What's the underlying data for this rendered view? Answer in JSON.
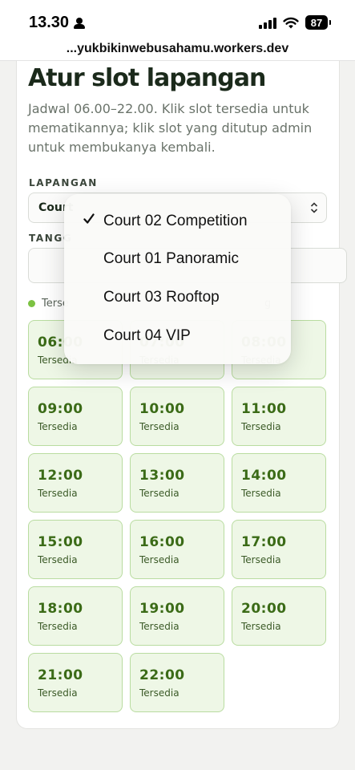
{
  "status_bar": {
    "time": "13.30",
    "battery": "87"
  },
  "browser": {
    "url": "...yukbikinwebusahamu.workers.dev"
  },
  "page": {
    "title": "Atur slot lapangan",
    "description": "Jadwal 06.00–22.00. Klik slot tersedia untuk mematikannya; klik slot yang ditutup admin untuk membukanya kembali.",
    "court_label": "LAPANGAN",
    "court_selected_partial": "Court",
    "date_label_partial": "TANGG",
    "legend_available_partial": "Terse",
    "legend_right_partial": "g"
  },
  "slots": [
    {
      "time": "06:00",
      "status": "Tersedia"
    },
    {
      "time": "07:00",
      "status": "Tersedia"
    },
    {
      "time": "08:00",
      "status": "Tersedia"
    },
    {
      "time": "09:00",
      "status": "Tersedia"
    },
    {
      "time": "10:00",
      "status": "Tersedia"
    },
    {
      "time": "11:00",
      "status": "Tersedia"
    },
    {
      "time": "12:00",
      "status": "Tersedia"
    },
    {
      "time": "13:00",
      "status": "Tersedia"
    },
    {
      "time": "14:00",
      "status": "Tersedia"
    },
    {
      "time": "15:00",
      "status": "Tersedia"
    },
    {
      "time": "16:00",
      "status": "Tersedia"
    },
    {
      "time": "17:00",
      "status": "Tersedia"
    },
    {
      "time": "18:00",
      "status": "Tersedia"
    },
    {
      "time": "19:00",
      "status": "Tersedia"
    },
    {
      "time": "20:00",
      "status": "Tersedia"
    },
    {
      "time": "21:00",
      "status": "Tersedia"
    },
    {
      "time": "22:00",
      "status": "Tersedia"
    }
  ],
  "dropdown": {
    "selected_index": 0,
    "options": [
      "Court 02 Competition",
      "Court 01 Panoramic",
      "Court 03 Rooftop",
      "Court 04 VIP"
    ]
  },
  "colors": {
    "slot_bg": "#eef7e6",
    "slot_border": "#b9dca0",
    "slot_time": "#3b6b17",
    "legend_dot": "#7cc242"
  },
  "icons": [
    "person-icon",
    "signal-icon",
    "wifi-icon",
    "battery-icon",
    "chevron-updown-icon",
    "checkmark-icon"
  ]
}
